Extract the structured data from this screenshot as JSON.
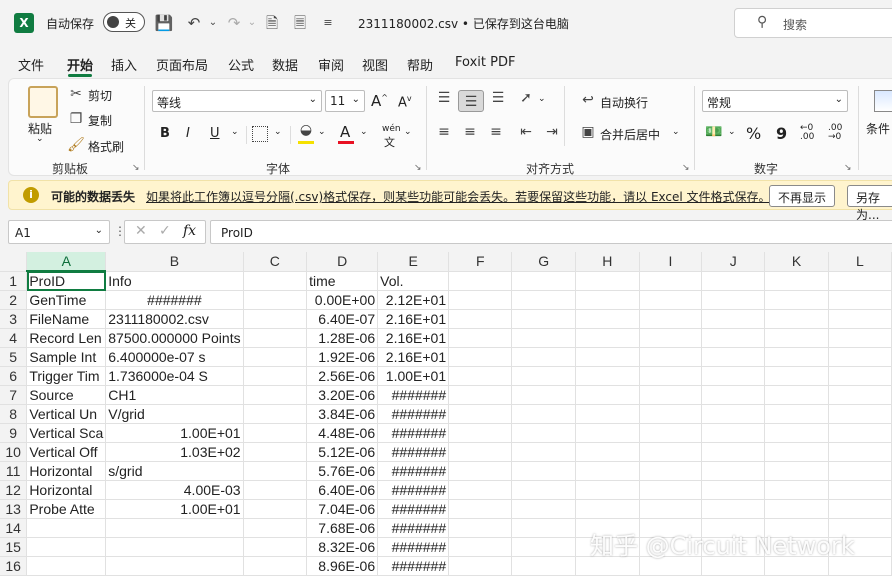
{
  "titlebar": {
    "autosave_label": "自动保存",
    "autosave_state": "关",
    "doc_title": "2311180002.csv • 已保存到这台电脑",
    "search_placeholder": "搜索",
    "logo_letter": "X"
  },
  "tabs": [
    "文件",
    "开始",
    "插入",
    "页面布局",
    "公式",
    "数据",
    "审阅",
    "视图",
    "帮助",
    "Foxit PDF"
  ],
  "active_tab": "开始",
  "ribbon": {
    "clipboard": {
      "paste": "粘贴",
      "cut": "剪切",
      "copy": "复制",
      "format_painter": "格式刷",
      "group_label": "剪贴板"
    },
    "font": {
      "font_name": "等线",
      "font_size": "11",
      "grow": "A",
      "shrink": "A",
      "bold": "B",
      "italic": "I",
      "underline": "U",
      "phonetic": "wén",
      "group_label": "字体"
    },
    "alignment": {
      "wrap_text": "自动换行",
      "merge_center": "合并后居中",
      "group_label": "对齐方式"
    },
    "number": {
      "format": "常规",
      "percent": "%",
      "comma": "9",
      "inc_decimal": "←0 .00",
      "dec_decimal": ".00 →0",
      "group_label": "数字"
    },
    "styles": {
      "cond_label": "条件"
    }
  },
  "infobar": {
    "title": "可能的数据丢失",
    "message": "如果将此工作簿以逗号分隔(.csv)格式保存，则某些功能可能会丢失。若要保留这些功能，请以 Excel 文件格式保存。",
    "dont_show": "不再显示",
    "save_as": "另存为..."
  },
  "formula_bar": {
    "name_box": "A1",
    "fx": "fx",
    "content": "ProID"
  },
  "sheet": {
    "columns": [
      "A",
      "B",
      "C",
      "D",
      "E",
      "F",
      "G",
      "H",
      "I",
      "J",
      "K",
      "L"
    ],
    "selected_column": "A",
    "rows": [
      {
        "n": "1",
        "A": "ProID",
        "B": "Info",
        "C": "",
        "D": "time",
        "E": "Vol."
      },
      {
        "n": "2",
        "A": "GenTime",
        "B": "#######",
        "C": "",
        "D": "0.00E+00",
        "E": "2.12E+01"
      },
      {
        "n": "3",
        "A": "FileName",
        "B": "2311180002.csv",
        "C": "",
        "D": "6.40E-07",
        "E": "2.16E+01"
      },
      {
        "n": "4",
        "A": "Record Len",
        "B": "87500.000000 Points",
        "C": "",
        "D": "1.28E-06",
        "E": "2.16E+01"
      },
      {
        "n": "5",
        "A": "Sample Int",
        "B": "6.400000e-07 s",
        "C": "",
        "D": "1.92E-06",
        "E": "2.16E+01"
      },
      {
        "n": "6",
        "A": "Trigger Tim",
        "B": "1.736000e-04 S",
        "C": "",
        "D": "2.56E-06",
        "E": "1.00E+01"
      },
      {
        "n": "7",
        "A": "Source",
        "B": "CH1",
        "C": "",
        "D": "3.20E-06",
        "E": "#######"
      },
      {
        "n": "8",
        "A": "Vertical Un",
        "B": "V/grid",
        "C": "",
        "D": "3.84E-06",
        "E": "#######"
      },
      {
        "n": "9",
        "A": "Vertical Sca",
        "B": "1.00E+01",
        "C": "",
        "D": "4.48E-06",
        "E": "#######"
      },
      {
        "n": "10",
        "A": "Vertical Off",
        "B": "1.03E+02",
        "C": "",
        "D": "5.12E-06",
        "E": "#######"
      },
      {
        "n": "11",
        "A": "Horizontal",
        "B": "s/grid",
        "C": "",
        "D": "5.76E-06",
        "E": "#######"
      },
      {
        "n": "12",
        "A": "Horizontal",
        "B": "4.00E-03",
        "C": "",
        "D": "6.40E-06",
        "E": "#######"
      },
      {
        "n": "13",
        "A": "Probe Atte",
        "B": "1.00E+01",
        "C": "",
        "D": "7.04E-06",
        "E": "#######"
      },
      {
        "n": "14",
        "A": "",
        "B": "",
        "C": "",
        "D": "7.68E-06",
        "E": "#######"
      },
      {
        "n": "15",
        "A": "",
        "B": "",
        "C": "",
        "D": "8.32E-06",
        "E": "#######"
      },
      {
        "n": "16",
        "A": "",
        "B": "",
        "C": "",
        "D": "8.96E-06",
        "E": "#######"
      }
    ]
  },
  "watermark": "知乎 @Circuit Network",
  "colors": {
    "accent": "#107c41",
    "info_bg": "#fff4ce",
    "selected_header": "#d3f0e0"
  }
}
